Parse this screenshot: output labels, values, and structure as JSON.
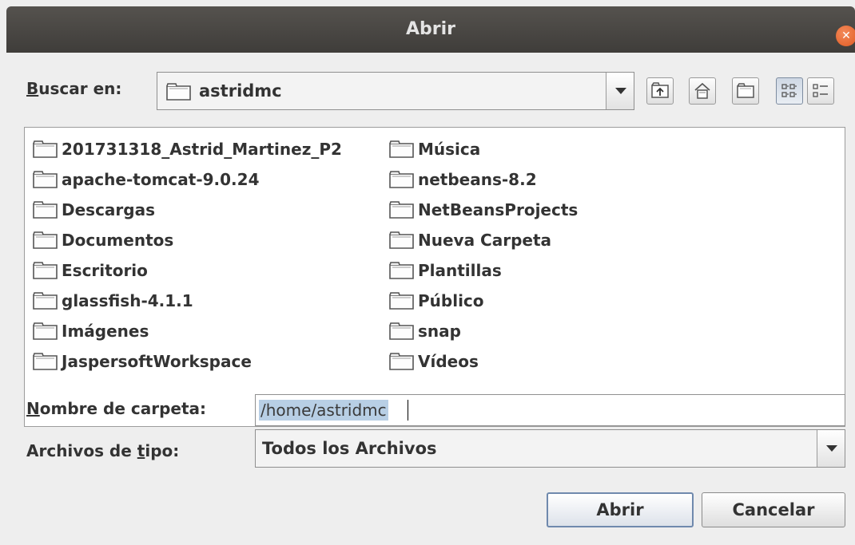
{
  "window": {
    "title": "Abrir"
  },
  "look_in": {
    "label_underlined": "B",
    "label_rest": "uscar en:",
    "value": "astridmc"
  },
  "toolbar": {
    "icons": [
      "up-one-level-icon",
      "home-icon",
      "new-folder-icon",
      "list-view-icon",
      "details-view-icon"
    ],
    "active": "list-view"
  },
  "files": {
    "column1": [
      "201731318_Astrid_Martinez_P2",
      "apache-tomcat-9.0.24",
      "Descargas",
      "Documentos",
      "Escritorio",
      "glassfish-4.1.1",
      "Imágenes",
      "JaspersoftWorkspace"
    ],
    "column2": [
      "Música",
      "netbeans-8.2",
      "NetBeansProjects",
      "Nueva Carpeta",
      "Plantillas",
      "Público",
      "snap",
      "Vídeos"
    ]
  },
  "folder_name": {
    "label_underlined": "N",
    "label_rest": "ombre de carpeta:",
    "value": "/home/astridmc"
  },
  "file_type": {
    "label_prefix": "Archivos de ",
    "label_underlined": "t",
    "label_rest": "ipo:",
    "value": "Todos los Archivos"
  },
  "buttons": {
    "open": "Abrir",
    "cancel": "Cancelar"
  },
  "colors": {
    "titlebar": "#4a4845",
    "close": "#e65f2a",
    "selection": "#b8cfe5",
    "default_button_border": "#6f89ad"
  }
}
